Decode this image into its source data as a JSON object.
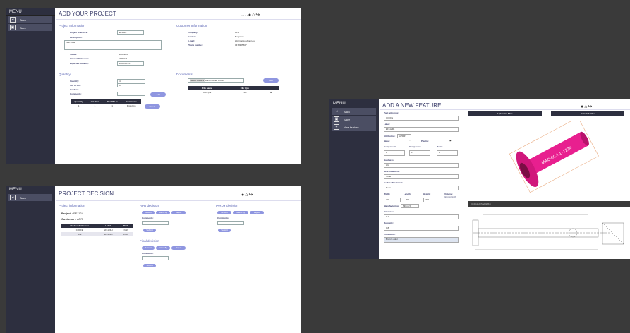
{
  "add_project": {
    "menu": "MENU",
    "items": [
      "Back",
      "Save"
    ],
    "title": "ADD YOUR PROJECT",
    "top_small": "user",
    "project_info": "Project Information",
    "pr_lbl": "Project reference:",
    "pr_val": "EF1124",
    "desc_lbl": "Description:",
    "desc_val": "Sun pose",
    "status_lbl": "Status:",
    "status_val": "Submitted",
    "ir_lbl": "Internal Reference:",
    "ir_val": "APR37-5",
    "ed_lbl": "Expected Delivery:",
    "ed_val": "2020-02-15",
    "customer_info": "Customer Information",
    "company_lbl": "Company:",
    "company_val": "APR",
    "contact_lbl": "Contact:",
    "contact_val": "Benjamin",
    "email_lbl": "E-mail:",
    "email_val": "informatique@apr.eu",
    "phone_lbl": "Phone number:",
    "phone_val": "0478325507",
    "quantity": "Quantity",
    "q_lbl": "Quantity:",
    "q_val": "4",
    "nol_lbl": "Nbr Of Lot:",
    "nol_val": "8",
    "ls_lbl": "Lot Size:",
    "ls_val": "",
    "com_lbl": "Comments:",
    "add_btn": "Add",
    "qtable": {
      "headers": [
        "Quantity",
        "Lot Size",
        "Nbr Of Lot",
        "Comments"
      ],
      "row": [
        "1",
        "1",
        "1",
        "Prototype"
      ]
    },
    "delete_btn": "Delete",
    "documents": "Documents",
    "browse": "Select Folders",
    "browse_txt": "Aucun fichier choisi",
    "add2": "Add",
    "dtable": {
      "headers": [
        "File name",
        "File type"
      ],
      "row": [
        "coffit.pdf",
        "PDF"
      ]
    }
  },
  "decision": {
    "menu": "MENU",
    "items": [
      "Back"
    ],
    "title": "PROJECT DECISION",
    "project_info": "Project information",
    "project_lbl": "Project :",
    "project_val": "EF1124",
    "customer_lbl": "Customer :",
    "customer_val": "APR",
    "table": {
      "headers": [
        "Product Reference",
        "Label",
        "Rank"
      ],
      "rows": [
        [
          "COFFE",
          "EF1124H",
          "high"
        ],
        [
          "A12",
          "EF1124D",
          "LOW"
        ]
      ]
    },
    "apr": "APR decision",
    "tardy": "TARDY decision",
    "final": "Final decision",
    "btns": [
      "Accept",
      "Stand By",
      "Reject"
    ],
    "comments": "Comments:",
    "submit": "Submit"
  },
  "feature": {
    "menu": "MENU",
    "items": [
      "Back",
      "Save",
      "New feature"
    ],
    "title": "ADD A NEW FEATURE",
    "part_lbl": "Part reference:",
    "part_val": "COFFE",
    "label_lbl": "Label:",
    "label_val": "EF1124B",
    "attr_lbl": "Attribution:",
    "attr_val": "APR",
    "metal": "Metal:",
    "plastic": "Plastic:",
    "comp": "Component:",
    "compound": "Compound:",
    "ratio": "Ratio:",
    "comp_val": "1",
    "compound_val": "1",
    "ratio_val": "1",
    "hard_lbl": "Hardness:",
    "hard_val": "HU",
    "heat_lbl": "Heat Treatment:",
    "heat_val": "None",
    "surf_lbl": "Surface Treatment:",
    "surf_val": "None",
    "width": "Width:",
    "length": "Length:",
    "height": "Height:",
    "volume": "Volume:",
    "volume_sub": "(in mm/cm3)",
    "w_val": "300",
    "l_val": "200",
    "h_val": "200",
    "man_lbl": "Manufacturing:",
    "man_val": "Milling",
    "tol_lbl": "Tolerance:",
    "tol_val": "0.1",
    "rug_lbl": "Rugosity:",
    "rug_val": "0.8",
    "com_lbl": "Comments:",
    "com_val": "Bronze color",
    "uploaded": "Uploaded Files",
    "selected": "Selected Files",
    "part_text": "MAC-0CA-L-1234",
    "drawing_label": "Unfolded (SaddleBy)"
  }
}
